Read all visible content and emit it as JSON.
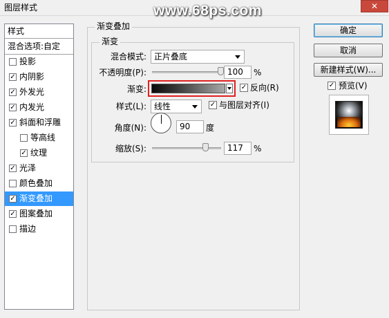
{
  "window": {
    "title": "图层样式",
    "close_glyph": "✕"
  },
  "watermark": "www.68ps.com",
  "styles_panel": {
    "header": "样式",
    "blend_options": "混合选项:自定",
    "items": [
      {
        "label": "投影",
        "checked": false
      },
      {
        "label": "内阴影",
        "checked": true
      },
      {
        "label": "外发光",
        "checked": true
      },
      {
        "label": "内发光",
        "checked": true
      },
      {
        "label": "斜面和浮雕",
        "checked": true
      },
      {
        "label": "等高线",
        "checked": false
      },
      {
        "label": "纹理",
        "checked": true
      },
      {
        "label": "光泽",
        "checked": true
      },
      {
        "label": "颜色叠加",
        "checked": false
      },
      {
        "label": "渐变叠加",
        "checked": true,
        "selected": true
      },
      {
        "label": "图案叠加",
        "checked": true
      },
      {
        "label": "描边",
        "checked": false
      }
    ]
  },
  "gradient_overlay": {
    "group_title": "渐变叠加",
    "subgroup_title": "渐变",
    "blend_mode_label": "混合模式:",
    "blend_mode_value": "正片叠底",
    "opacity_label": "不透明度(P):",
    "opacity_value": "100",
    "opacity_level": 1.0,
    "percent": "%",
    "gradient_label": "渐变:",
    "reverse_label": "反向(R)",
    "reverse_checked": true,
    "style_label": "样式(L):",
    "style_value": "线性",
    "align_label": "与图层对齐(I)",
    "align_checked": true,
    "angle_label": "角度(N):",
    "angle_value": "90",
    "degree": "度",
    "scale_label": "缩放(S):",
    "scale_value": "117",
    "scale_level": 0.78,
    "check_glyph": "✓"
  },
  "buttons": {
    "ok": "确定",
    "cancel": "取消",
    "new_style": "新建样式(W)...",
    "preview": "预览(V)",
    "preview_checked": true
  }
}
